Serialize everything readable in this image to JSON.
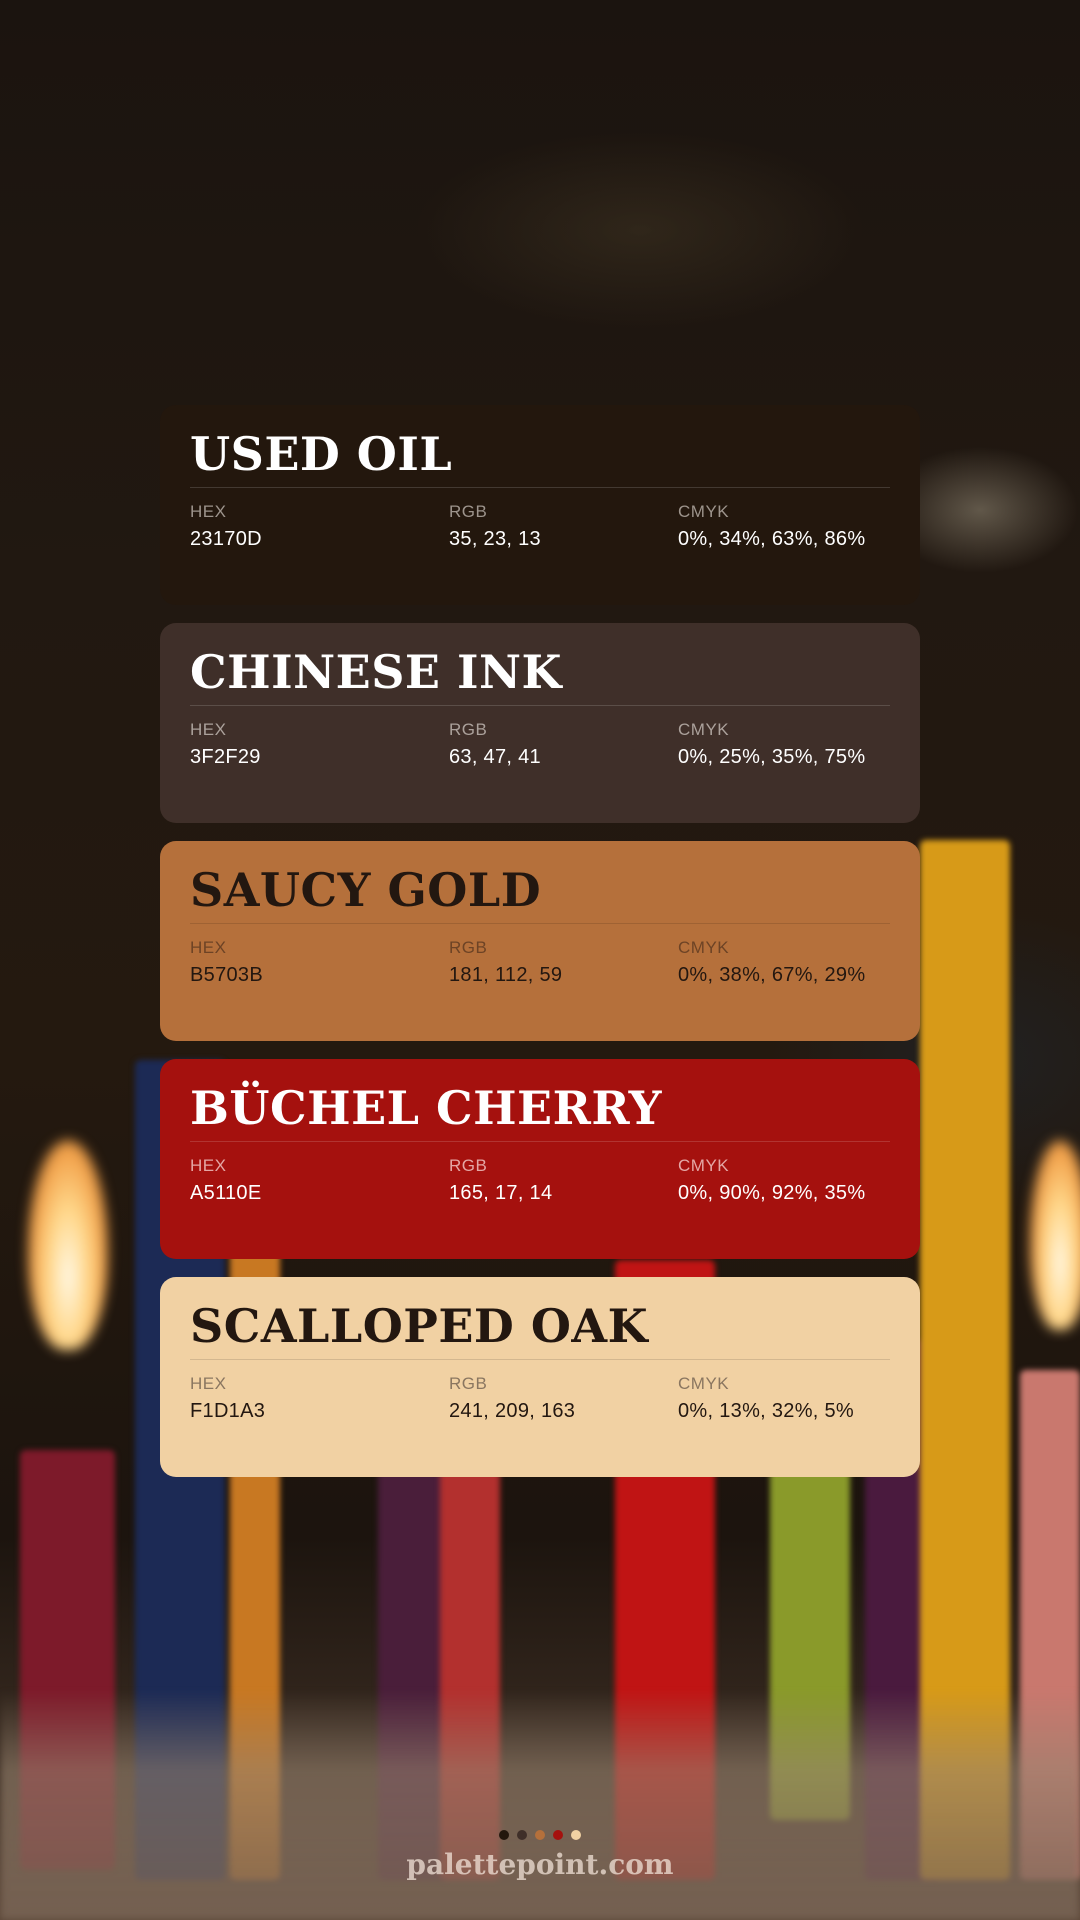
{
  "background": {
    "description_icon": "birthday-candles-photo"
  },
  "palette": [
    {
      "name": "USED OIL",
      "hex": "23170D",
      "rgb": "35, 23, 13",
      "cmyk": "0%, 34%, 63%, 86%",
      "card_color": "#23170d",
      "text_color": "#ffffff",
      "label_color": "#9d948c",
      "theme": "dark"
    },
    {
      "name": "CHINESE INK",
      "hex": "3F2F29",
      "rgb": "63, 47, 41",
      "cmyk": "0%, 25%, 35%, 75%",
      "card_color": "#3f2f29",
      "text_color": "#ffffff",
      "label_color": "#aba19b",
      "theme": "dark"
    },
    {
      "name": "SAUCY GOLD",
      "hex": "B5703B",
      "rgb": "181, 112, 59",
      "cmyk": "0%, 38%, 67%, 29%",
      "card_color": "#b5703b",
      "text_color": "#231710",
      "label_color": "#6d4325",
      "theme": "light"
    },
    {
      "name": "BÜCHEL CHERRY",
      "hex": "A5110E",
      "rgb": "165, 17, 14",
      "cmyk": "0%, 90%, 92%, 35%",
      "card_color": "#a5110e",
      "text_color": "#ffffff",
      "label_color": "#e4a7a5",
      "theme": "dark"
    },
    {
      "name": "SCALLOPED OAK",
      "hex": "F1D1A3",
      "rgb": "241, 209, 163",
      "cmyk": "0%, 13%, 32%, 5%",
      "card_color": "#f1d1a3",
      "text_color": "#231710",
      "label_color": "#8a7660",
      "theme": "light"
    }
  ],
  "labels": {
    "hex": "HEX",
    "rgb": "RGB",
    "cmyk": "CMYK"
  },
  "pagination": {
    "dot_colors": [
      "#23170d",
      "#3f2f29",
      "#b5703b",
      "#a5110e",
      "#f1d1a3"
    ]
  },
  "footer": {
    "site": "palettepoint.com"
  }
}
